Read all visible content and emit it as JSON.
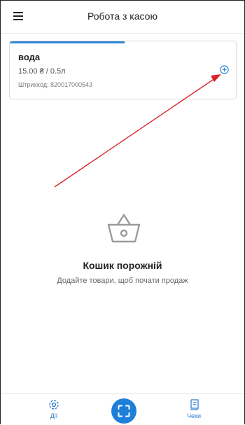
{
  "header": {
    "title": "Робота з касою",
    "menu_icon": "menu-icon"
  },
  "cart_item": {
    "name": "вода",
    "price": "15.00 ₴ / 0.5л",
    "barcode": "Штрихкод: 820017000543",
    "add_icon": "plus-circle-icon"
  },
  "empty_state": {
    "icon": "basket-icon",
    "title": "Кошик порожній",
    "subtitle": "Додайте товари, щоб почати продаж"
  },
  "bottom_nav": {
    "actions_label": "Дії",
    "actions_icon": "gear-icon",
    "scan_icon": "scan-icon",
    "receipts_label": "Чеки",
    "receipts_icon": "receipt-icon"
  },
  "colors": {
    "accent": "#1e7fd9",
    "annotation_arrow": "#d9222a"
  }
}
